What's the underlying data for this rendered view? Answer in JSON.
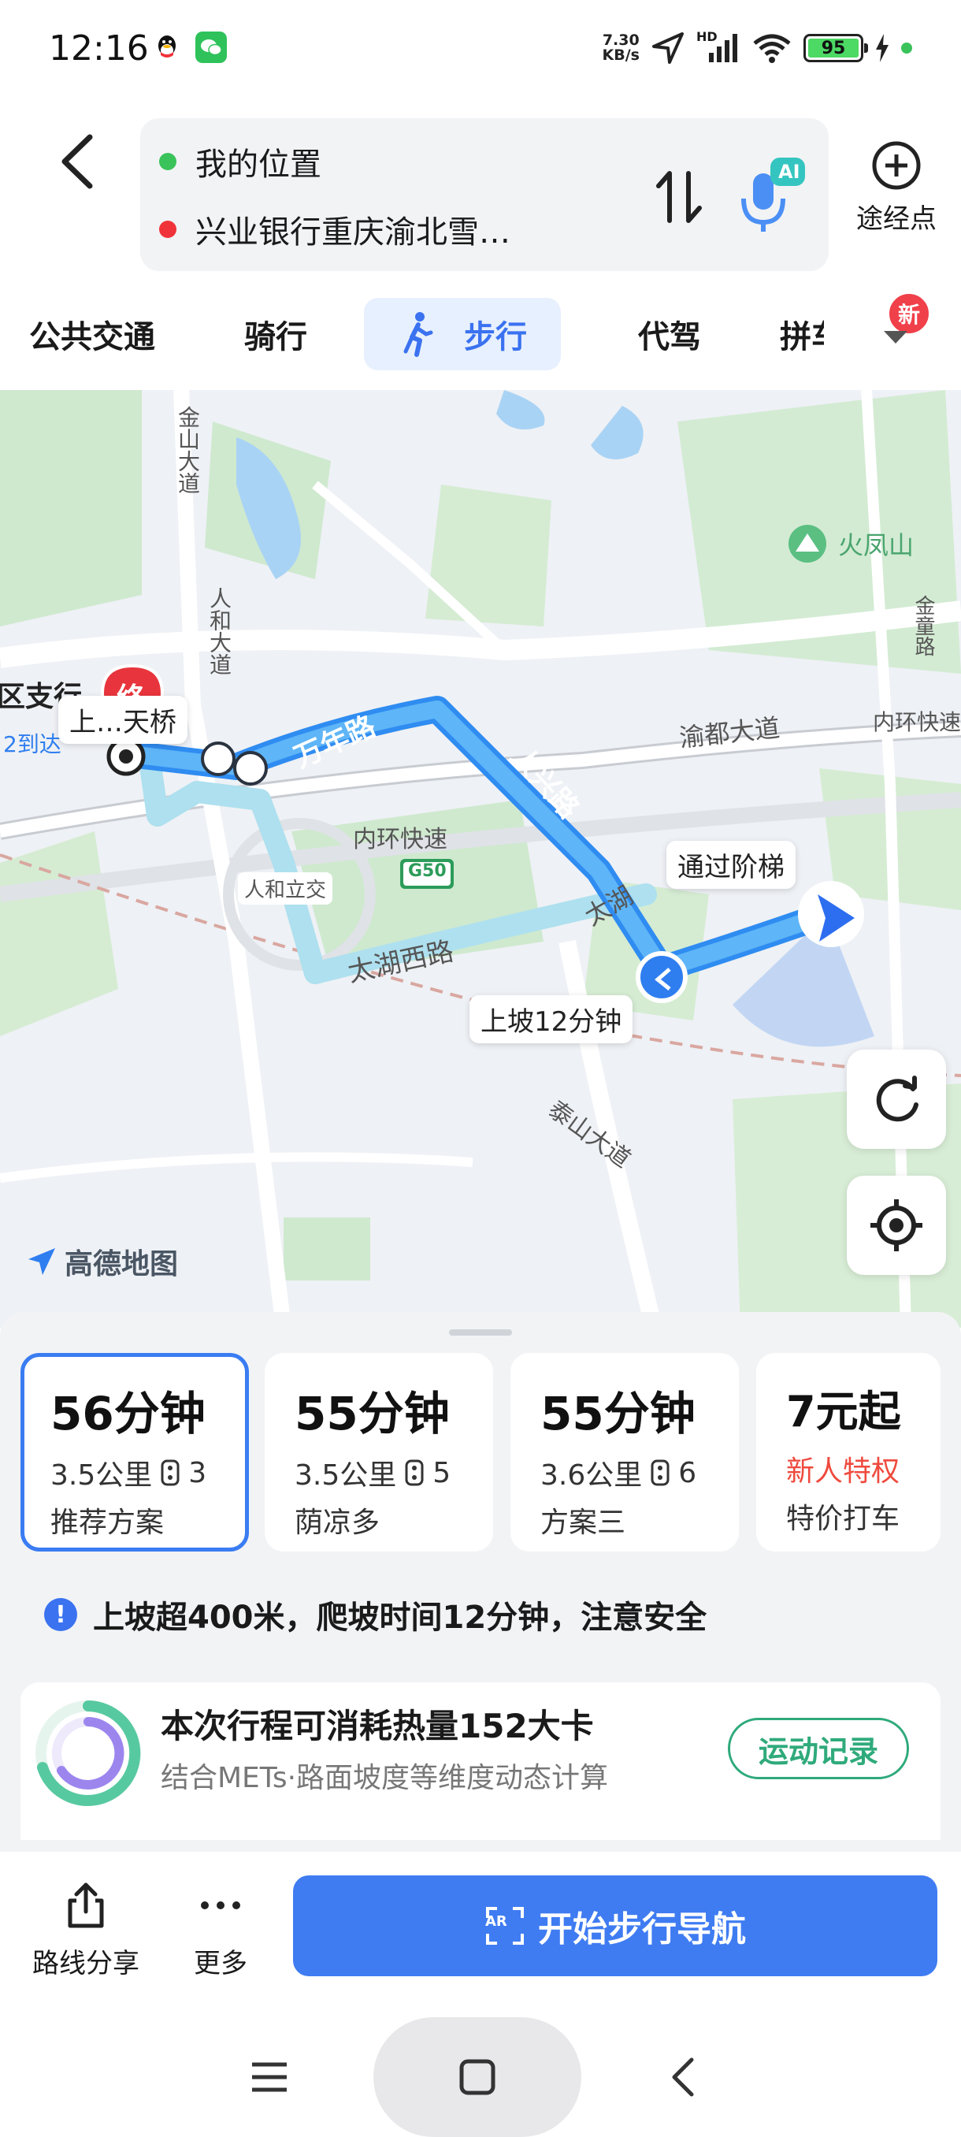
{
  "status_bar": {
    "time": "12:16",
    "net_speed_value": "7.30",
    "net_speed_unit": "KB/s",
    "signal_label": "HD",
    "battery": "95",
    "icons": [
      "qq-icon",
      "wechat-icon",
      "location-arrow-icon",
      "signal-icon",
      "wifi-icon",
      "battery-icon",
      "charging-icon"
    ]
  },
  "header": {
    "origin": "我的位置",
    "destination": "兴业银行重庆渝北雪…",
    "waypoint_label": "途经点",
    "ai_badge": "AI"
  },
  "tabs": [
    {
      "label": "公共交通",
      "active": false
    },
    {
      "label": "骑行",
      "active": false
    },
    {
      "label": "步行",
      "active": true
    },
    {
      "label": "代驾",
      "active": false
    },
    {
      "label": "拼车",
      "active": false
    }
  ],
  "new_badge": "新",
  "map": {
    "labels": {
      "jinshan_road": "金山大道",
      "renhe_road": "人和大道",
      "huofeng_mountain": "火凤山",
      "jintong_road": "金童路",
      "yudu_road": "渝都大道",
      "inner_ring_fast": "内环快速",
      "wannian_road": "万年路",
      "renxing_road": "人兴路",
      "taihu_road": "太湖",
      "taihu_west_road": "太湖西路",
      "inner_ring_expressway": "内环快速",
      "highway_code": "G50",
      "renhe_interchange": "人和立交",
      "taishan_road": "泰山大道",
      "branch_partial": "区支行",
      "route_partial": "2到达",
      "bridge_partial": "上…天桥",
      "end_marker": "终",
      "logo": "高德地图"
    },
    "callouts": {
      "stairs": "通过阶梯",
      "uphill": "上坡12分钟"
    }
  },
  "plans": [
    {
      "time": "56分钟",
      "distance": "3.5公里",
      "lights": "3",
      "tag": "推荐方案",
      "selected": true
    },
    {
      "time": "55分钟",
      "distance": "3.5公里",
      "lights": "5",
      "tag": "荫凉多",
      "selected": false
    },
    {
      "time": "55分钟",
      "distance": "3.6公里",
      "lights": "6",
      "tag": "方案三",
      "selected": false
    },
    {
      "time": "7元起",
      "promo": "新人特权",
      "tag": "特价打车",
      "selected": false
    }
  ],
  "notice": "上坡超400米，爬坡时间12分钟，注意安全",
  "calorie": {
    "title": "本次行程可消耗热量152大卡",
    "subtitle": "结合METs·路面坡度等维度动态计算",
    "button": "运动记录"
  },
  "actions": {
    "share": "路线分享",
    "more": "更多",
    "start_nav": "开始步行导航",
    "ar_label": "AR"
  }
}
